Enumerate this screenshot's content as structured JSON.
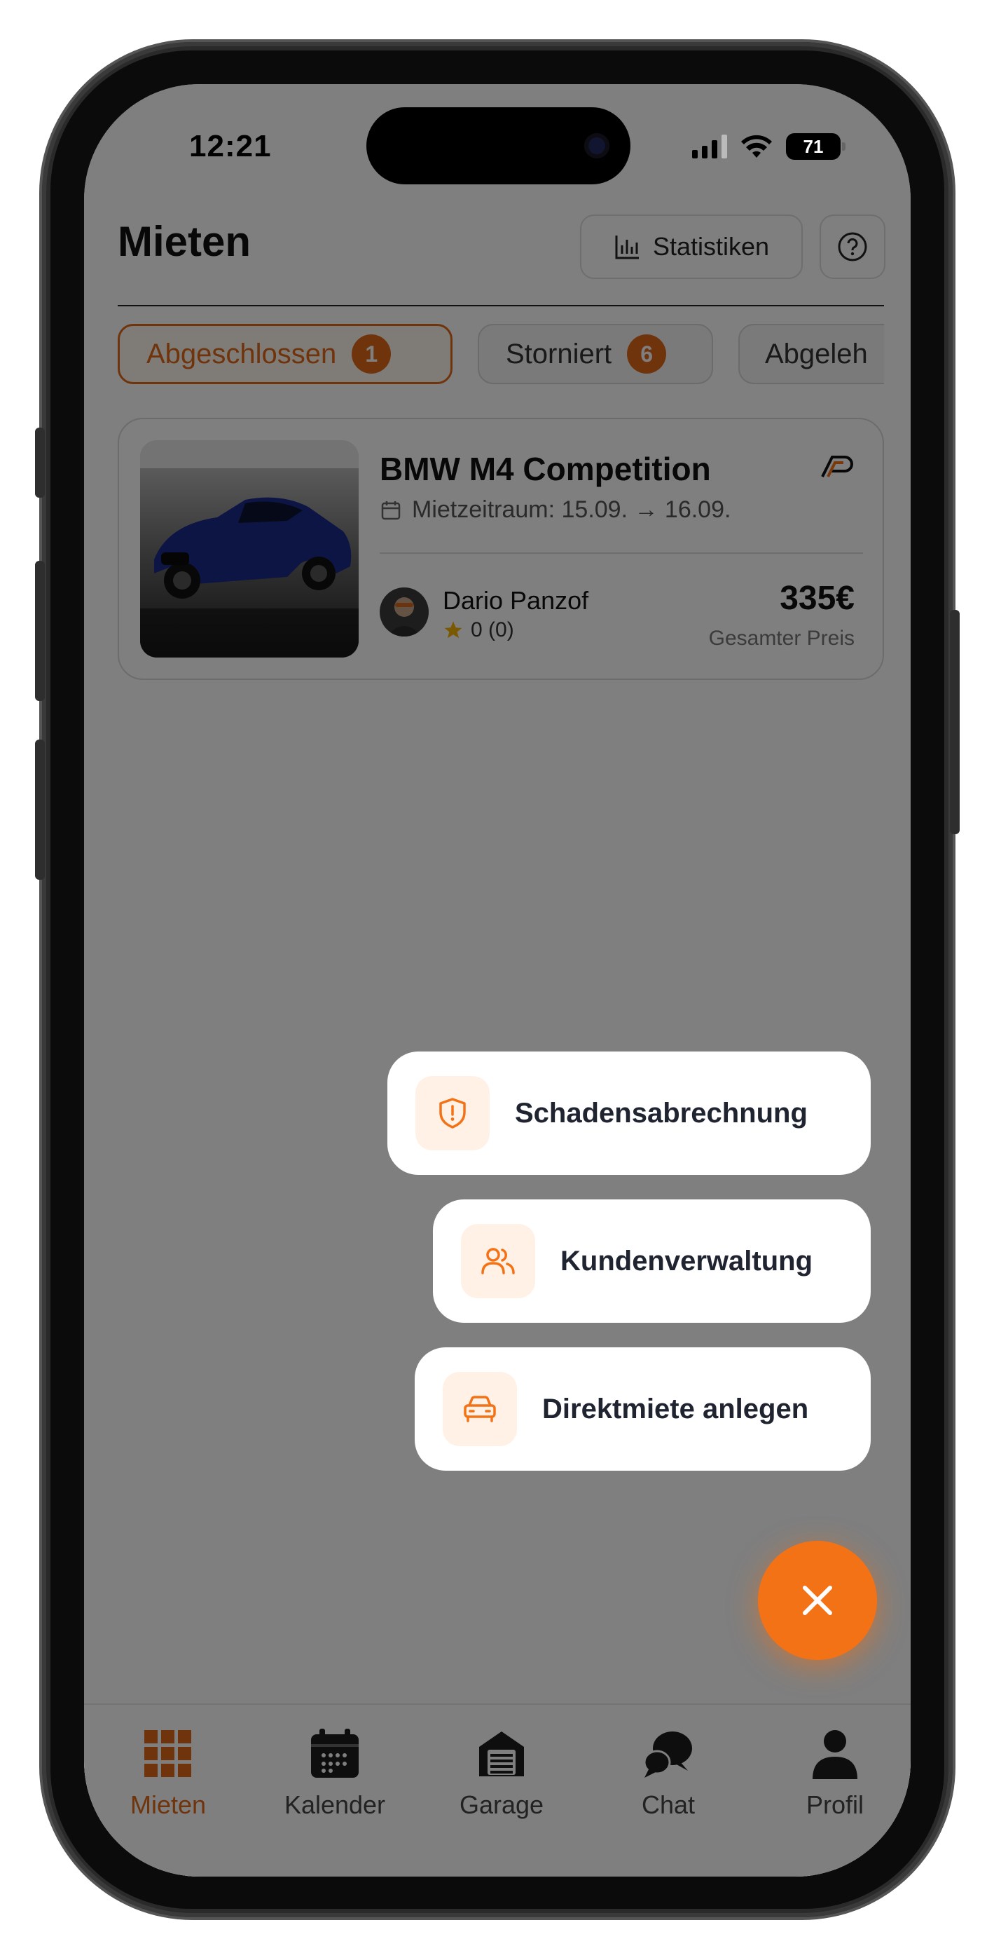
{
  "status_bar": {
    "time": "12:21",
    "battery": "71"
  },
  "header": {
    "title": "Mieten",
    "stats_label": "Statistiken"
  },
  "tabs": [
    {
      "label": "Abgeschlossen",
      "count": "1"
    },
    {
      "label": "Storniert",
      "count": "6"
    },
    {
      "label": "Abgeleh"
    }
  ],
  "rental": {
    "title": "BMW M4 Competition",
    "period": "Mietzeitraum: 15.09. → 16.09.",
    "owner": "Dario Panzof",
    "rating": "0 (0)",
    "price": "335€",
    "price_label": "Gesamter Preis"
  },
  "fab_menu": [
    {
      "label": "Schadensabrechnung",
      "icon": "shield-alert-icon"
    },
    {
      "label": "Kundenverwaltung",
      "icon": "users-icon"
    },
    {
      "label": "Direktmiete anlegen",
      "icon": "car-icon"
    }
  ],
  "bottom_nav": [
    {
      "label": "Mieten",
      "icon": "grid-icon"
    },
    {
      "label": "Kalender",
      "icon": "calendar-icon"
    },
    {
      "label": "Garage",
      "icon": "garage-icon"
    },
    {
      "label": "Chat",
      "icon": "chat-icon"
    },
    {
      "label": "Profil",
      "icon": "person-icon"
    }
  ],
  "colors": {
    "accent": "#f47216",
    "accent_dark": "#e0691b",
    "overlay": "rgba(0,0,0,0.5)"
  }
}
